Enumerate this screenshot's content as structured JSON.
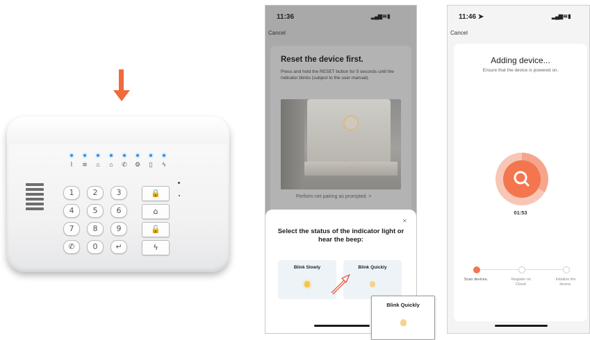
{
  "keypad": {
    "digits": [
      "1",
      "2",
      "3",
      "4",
      "5",
      "6",
      "7",
      "8",
      "9",
      "✆",
      "0",
      "↵"
    ],
    "function_keys": [
      "🔒",
      "⌂",
      "🔓",
      "ϟ"
    ],
    "status_icons": [
      "⌇",
      "≋",
      "⌂",
      "⌂",
      "✆",
      "⚙",
      "▯",
      "ϟ"
    ]
  },
  "phone1": {
    "time": "11:36",
    "signal": "▂▄▆ ≋ ▮",
    "cancel": "Cancel",
    "reset_title": "Reset the device first.",
    "reset_desc": "Press and hold the RESET button for 5 seconds until the indicator blinks (subject to the user manual).",
    "pairing_link": "Perform net pairing as prompted. >",
    "close": "✕",
    "sheet_title": "Select the status of the indicator light or hear the beep:",
    "option_slow": "Blink Slowly",
    "option_quick": "Blink Quickly"
  },
  "popup": {
    "label": "Blink Quickly"
  },
  "phone2": {
    "time": "11:46 ➤",
    "signal": "▂▄▆ ≋ ▮",
    "cancel": "Cancel",
    "title": "Adding device...",
    "subtitle": "Ensure that the device is powered on.",
    "search_icon": "search-icon",
    "timer": "01:53",
    "steps": [
      "Scan devices.",
      "Register on Cloud.",
      "Initialize the device."
    ]
  },
  "colors": {
    "accent": "#f06a3b",
    "led_blue": "#3a8fe0",
    "progress_orange": "#f37651"
  }
}
